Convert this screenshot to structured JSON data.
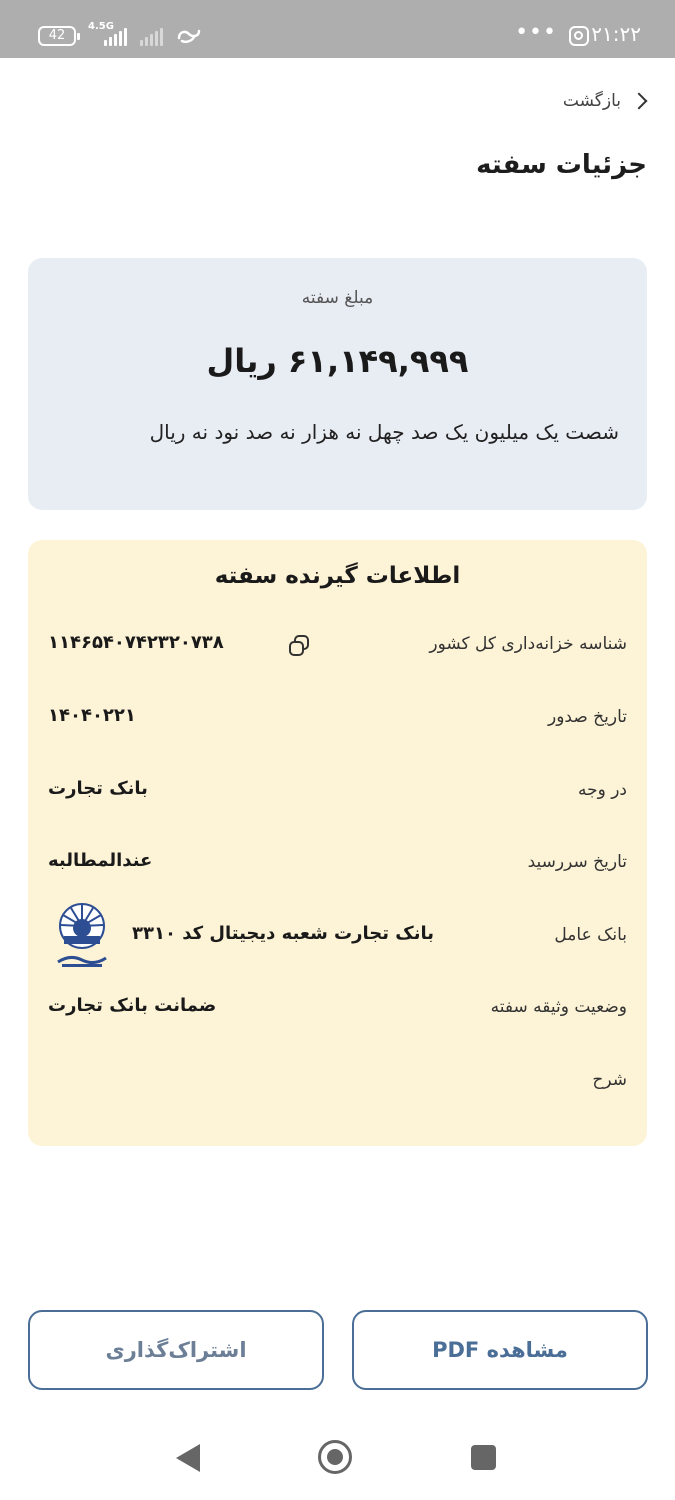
{
  "status_bar": {
    "time": "۲۱:۲۲",
    "battery": "42",
    "network": "4.5G",
    "overflow": "•••",
    "icons": [
      "instagram-icon",
      "signal-icon",
      "link-icon"
    ]
  },
  "header": {
    "back_label": "بازگشت",
    "title": "جزئیات سفته"
  },
  "amount": {
    "label": "مبلغ سفته",
    "value": "۶۱,۱۴۹,۹۹۹ ریال",
    "words": "شصت یک میلیون یک صد چهل نه هزار نه صد نود نه ریال"
  },
  "info": {
    "title": "اطلاعات گیرنده سفته",
    "rows": [
      {
        "label": "شناسه خزانه‌داری کل کشور",
        "value": "۱۱۴۶۵۴۰۷۴۲۳۲۰۷۳۸"
      },
      {
        "label": "تاریخ صدور",
        "value": "۱۴۰۴۰۲۲۱"
      },
      {
        "label": "در وجه",
        "value": "بانک تجارت"
      },
      {
        "label": "تاریخ سررسید",
        "value": "عندالمطالبه"
      },
      {
        "label": "بانک عامل",
        "value": "بانک تجارت شعبه دیجیتال کد ۳۳۱۰"
      },
      {
        "label": "وضعیت وثیقه سفته",
        "value": "ضمانت بانک تجارت"
      },
      {
        "label": "شرح",
        "value": ""
      }
    ],
    "bank_logo_text": "بانک تجارت"
  },
  "actions": {
    "pdf_label": "مشاهده PDF",
    "share_label": "اشتراک‌گذاری"
  },
  "colors": {
    "amount_card_bg": "#e8ecf3",
    "info_card_bg": "#fdf3d6",
    "button_accent": "#4a6e96",
    "status_bar_bg": "#aeaeae"
  }
}
